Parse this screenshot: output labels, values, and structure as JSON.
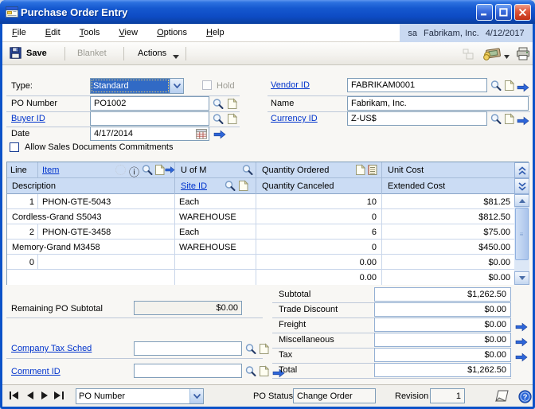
{
  "colors": {
    "titlebar_blue": "#1558cf",
    "selection_blue": "#316ac5",
    "link_blue": "#0033cc",
    "grid_header_bg": "#cbdcf4",
    "field_border": "#7f9db9",
    "user_area_bg": "#c9d9f1"
  },
  "window": {
    "title": "Purchase Order Entry"
  },
  "menu": {
    "items": [
      "File",
      "Edit",
      "Tools",
      "View",
      "Options",
      "Help"
    ],
    "user": "sa",
    "company": "Fabrikam, Inc.",
    "date": "4/12/2017"
  },
  "toolbar": {
    "save": "Save",
    "blanket": "Blanket",
    "actions": "Actions"
  },
  "form": {
    "type_label": "Type:",
    "type_value": "Standard",
    "hold_label": "Hold",
    "po_number_label": "PO Number",
    "po_number_value": "PO1002",
    "buyer_id_label": "Buyer ID",
    "buyer_id_value": "",
    "date_label": "Date",
    "date_value": "4/17/2014",
    "allow_commitments_label": "Allow Sales Documents Commitments",
    "vendor_id_label": "Vendor ID",
    "vendor_id_value": "FABRIKAM0001",
    "name_label": "Name",
    "name_value": "Fabrikam, Inc.",
    "currency_id_label": "Currency ID",
    "currency_id_value": "Z-US$"
  },
  "grid": {
    "headers": {
      "line": "Line",
      "item": "Item",
      "uom": "U of M",
      "qty_ordered": "Quantity Ordered",
      "unit_cost": "Unit Cost",
      "description": "Description",
      "site_id": "Site ID",
      "qty_canceled": "Quantity Canceled",
      "extended_cost": "Extended Cost"
    },
    "rows": [
      {
        "line": "1",
        "item": "PHON-GTE-5043",
        "uom": "Each",
        "qty_ordered": "10",
        "unit_cost": "$81.25",
        "description": "Cordless-Grand S5043",
        "site_id": "WAREHOUSE",
        "qty_canceled": "0",
        "extended_cost": "$812.50"
      },
      {
        "line": "2",
        "item": "PHON-GTE-3458",
        "uom": "Each",
        "qty_ordered": "6",
        "unit_cost": "$75.00",
        "description": "Memory-Grand M3458",
        "site_id": "WAREHOUSE",
        "qty_canceled": "0",
        "extended_cost": "$450.00"
      },
      {
        "line": "0",
        "item": "",
        "uom": "",
        "qty_ordered": "0.00",
        "unit_cost": "$0.00",
        "description": "",
        "site_id": "",
        "qty_canceled": "0.00",
        "extended_cost": "$0.00"
      }
    ]
  },
  "left_panel": {
    "remaining_label": "Remaining PO Subtotal",
    "remaining_value": "$0.00",
    "company_tax_label": "Company Tax Sched",
    "company_tax_value": "",
    "comment_id_label": "Comment ID",
    "comment_id_value": ""
  },
  "totals": {
    "rows": [
      {
        "label": "Subtotal",
        "value": "$1,262.50"
      },
      {
        "label": "Trade Discount",
        "value": "$0.00"
      },
      {
        "label": "Freight",
        "value": "$0.00"
      },
      {
        "label": "Miscellaneous",
        "value": "$0.00"
      },
      {
        "label": "Tax",
        "value": "$0.00"
      },
      {
        "label": "Total",
        "value": "$1,262.50"
      }
    ]
  },
  "statusbar": {
    "browse_by": "PO Number",
    "po_status_label": "PO Status",
    "po_status_value": "Change Order",
    "revision_label": "Revision",
    "revision_value": "1"
  }
}
